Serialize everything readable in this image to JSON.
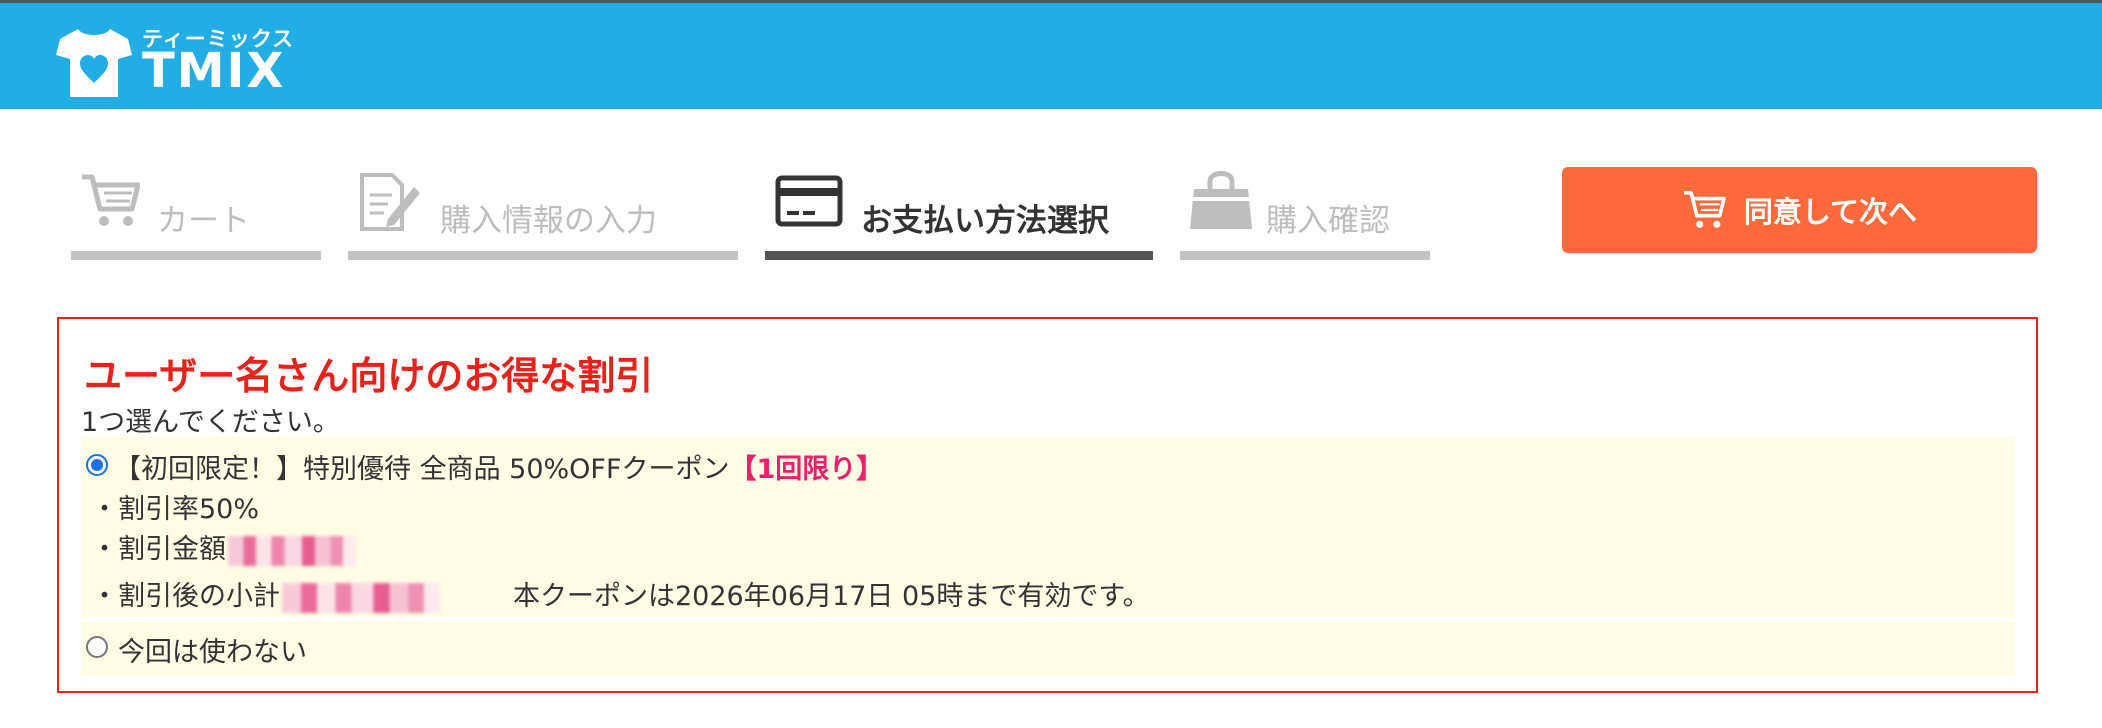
{
  "brand": {
    "kana": "ティーミックス",
    "name": "TMIX"
  },
  "steps": [
    {
      "label": "カート",
      "icon": "cart-icon",
      "active": false
    },
    {
      "label": "購入情報の入力",
      "icon": "document-edit-icon",
      "active": false
    },
    {
      "label": "お支払い方法選択",
      "icon": "credit-card-icon",
      "active": true
    },
    {
      "label": "購入確認",
      "icon": "shopping-bag-icon",
      "active": false
    }
  ],
  "next_button": {
    "label": "同意して次へ",
    "icon": "cart-icon"
  },
  "coupon": {
    "title": "ユーザー名さん向けのお得な割引",
    "subtitle": "1つ選んでください。",
    "option1": {
      "label": "【初回限定！】特別優待 全商品 50%OFFクーポン",
      "limit": "【1回限り】",
      "selected": true,
      "rate": "・割引率50%",
      "amount_label": "・割引金額",
      "subtotal_label": "・割引後の小計",
      "validity": "本クーポンは2026年06月17日 05時まで有効です。"
    },
    "option2": {
      "label": "今回は使わない",
      "selected": false
    }
  },
  "colors": {
    "header": "#22ade4",
    "accent": "#ff6a3d",
    "alert": "#e8211b",
    "limit": "#e8216b",
    "option_bg": "#fffde4"
  }
}
